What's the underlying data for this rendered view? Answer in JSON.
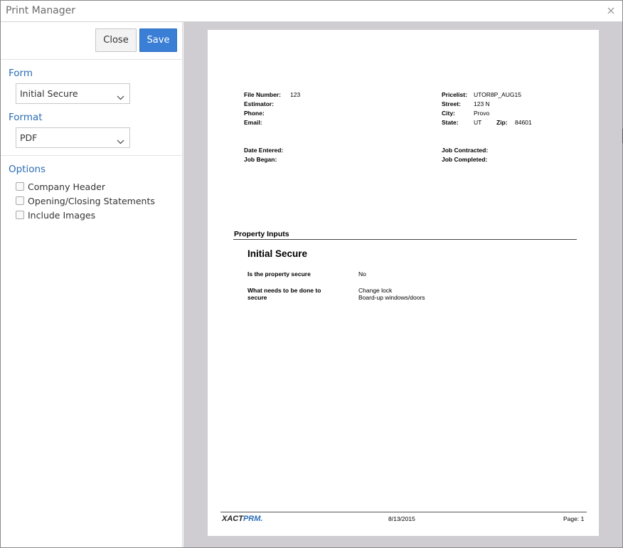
{
  "window": {
    "title": "Print Manager"
  },
  "toolbar": {
    "close_label": "Close",
    "save_label": "Save",
    "save_color": "#3a7fd5"
  },
  "form": {
    "label": "Form",
    "selected": "Initial Secure"
  },
  "format": {
    "label": "Format",
    "selected": "PDF"
  },
  "options": {
    "label": "Options",
    "items": [
      {
        "label": "Company Header",
        "checked": false
      },
      {
        "label": "Opening/Closing Statements",
        "checked": false
      },
      {
        "label": "Include Images",
        "checked": false
      }
    ]
  },
  "document": {
    "left_fields": [
      {
        "label": "File Number:",
        "value": "123"
      },
      {
        "label": "Estimator:",
        "value": ""
      },
      {
        "label": "Phone:",
        "value": ""
      },
      {
        "label": "Email:",
        "value": ""
      }
    ],
    "right_fields": [
      {
        "label": "Pricelist:",
        "value": "UTOR8P_AUG15"
      },
      {
        "label": "Street:",
        "value": "123 N"
      },
      {
        "label": "City:",
        "value": "Provo"
      },
      {
        "label": "State:",
        "value": "UT"
      }
    ],
    "zip_label": "Zip:",
    "zip_value": "84601",
    "dates_left": [
      {
        "label": "Date Entered:"
      },
      {
        "label": "Job Began:"
      }
    ],
    "dates_right": [
      {
        "label": "Job Contracted:"
      },
      {
        "label": "Job Completed:"
      }
    ],
    "section_title": "Property Inputs",
    "form_title": "Initial Secure",
    "questions": [
      {
        "question": "Is the property secure",
        "answer": "No"
      },
      {
        "question": "What needs to be done to secure",
        "answer_lines": [
          "Change lock",
          "Board-up windows/doors"
        ]
      }
    ],
    "footer": {
      "logo_part1": "XACT",
      "logo_part2": "PRM.",
      "date": "8/13/2015",
      "page": "Page: 1"
    }
  }
}
